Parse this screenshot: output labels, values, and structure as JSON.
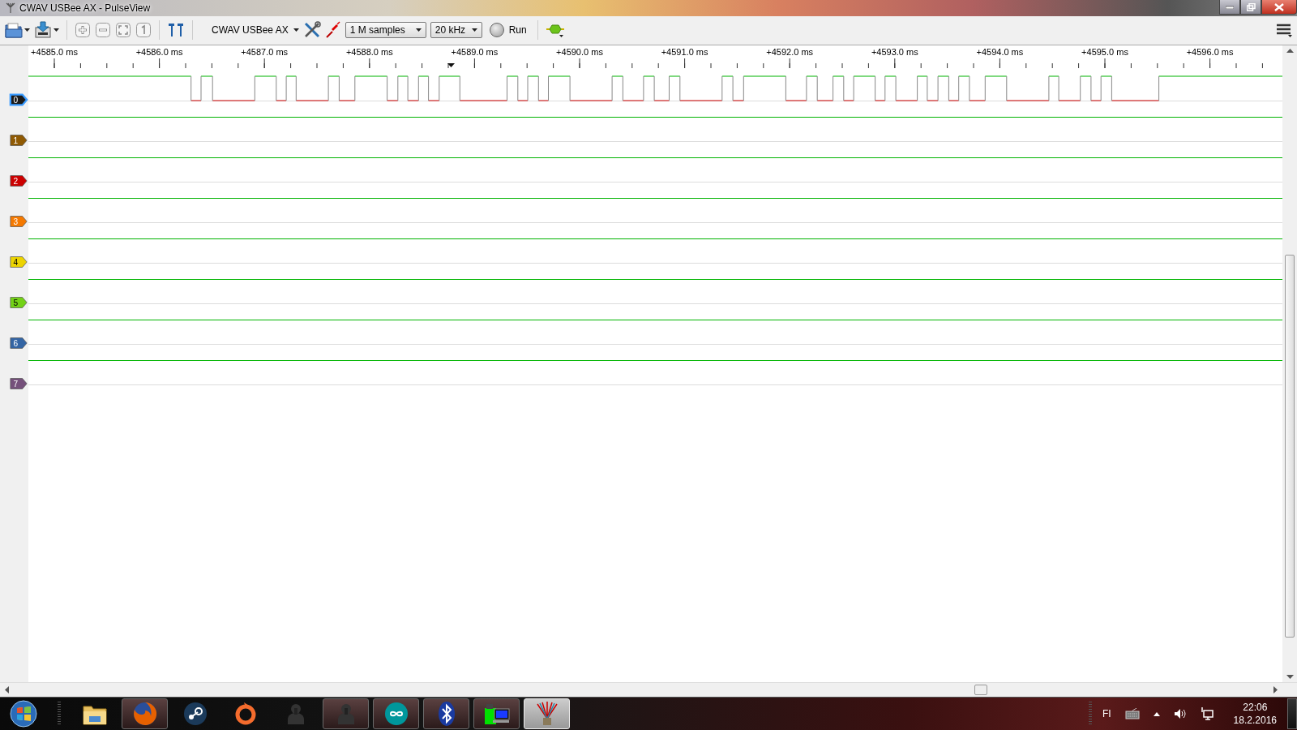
{
  "window": {
    "title": "CWAV USBee AX - PulseView"
  },
  "toolbar": {
    "device": "CWAV USBee AX",
    "sample_count": "1 M samples",
    "sample_rate": "20 kHz",
    "run_button": "Run"
  },
  "ruler": {
    "labels": [
      "+4585.0 ms",
      "+4586.0 ms",
      "+4587.0 ms",
      "+4588.0 ms",
      "+4589.0 ms",
      "+4590.0 ms",
      "+4591.0 ms",
      "+4592.0 ms",
      "+4593.0 ms",
      "+4594.0 ms",
      "+4595.0 ms",
      "+4596.0 ms"
    ]
  },
  "channels": [
    {
      "label": "0",
      "color": "#1a1a1a",
      "selected": true,
      "kind": "pulses"
    },
    {
      "label": "1",
      "color": "#8f5902",
      "selected": false,
      "kind": "high"
    },
    {
      "label": "2",
      "color": "#cc0000",
      "selected": false,
      "kind": "high"
    },
    {
      "label": "3",
      "color": "#f57900",
      "selected": false,
      "kind": "high"
    },
    {
      "label": "4",
      "color": "#edd400",
      "selected": false,
      "kind": "high"
    },
    {
      "label": "5",
      "color": "#73d216",
      "selected": false,
      "kind": "high"
    },
    {
      "label": "6",
      "color": "#3465a4",
      "selected": false,
      "kind": "high"
    },
    {
      "label": "7",
      "color": "#75507b",
      "selected": false,
      "kind": "high"
    }
  ],
  "taskbar": {
    "items": [
      {
        "kind": "folder",
        "running": false,
        "selected": false
      },
      {
        "kind": "firefox",
        "running": true,
        "selected": false
      },
      {
        "kind": "steam",
        "running": false,
        "selected": false
      },
      {
        "kind": "origin",
        "running": false,
        "selected": false
      },
      {
        "kind": "person",
        "running": false,
        "selected": false
      },
      {
        "kind": "person",
        "running": true,
        "selected": false
      },
      {
        "kind": "infinity",
        "running": true,
        "selected": false
      },
      {
        "kind": "bluetooth",
        "running": true,
        "selected": false
      },
      {
        "kind": "computer",
        "running": true,
        "selected": false
      },
      {
        "kind": "wires",
        "running": true,
        "selected": true
      }
    ],
    "language": "FI",
    "time": "22:06",
    "date": "18.2.2016"
  }
}
